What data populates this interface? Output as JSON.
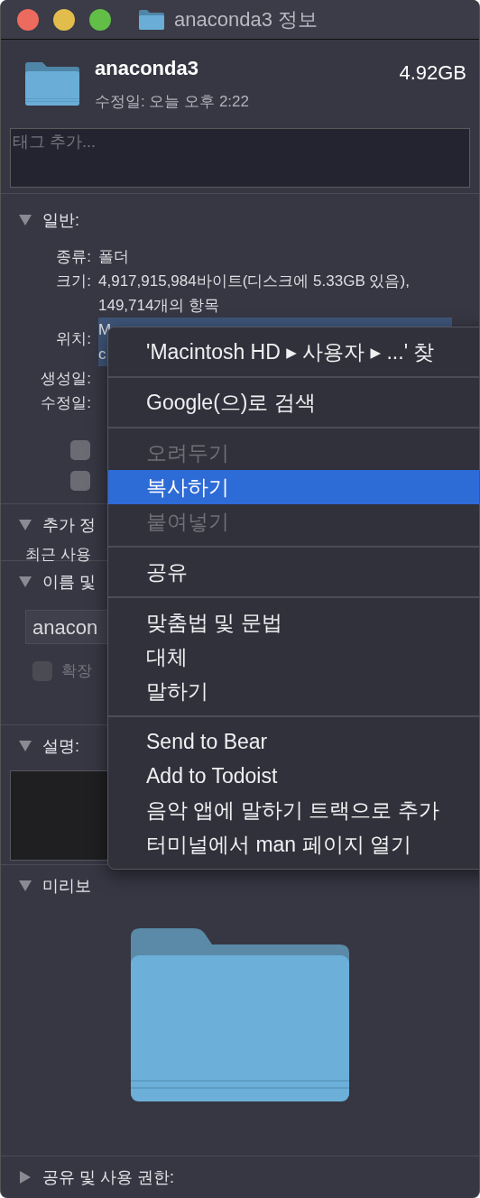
{
  "window": {
    "title": "anaconda3 정보"
  },
  "header": {
    "name": "anaconda3",
    "modified": "수정일: 오늘 오후 2:22",
    "size": "4.92GB"
  },
  "tags": {
    "placeholder": "태그 추가..."
  },
  "sections": [
    {
      "kind": "general",
      "title": "일반:",
      "expanded": true,
      "rows": [
        {
          "label": "종류:",
          "value": "폴더"
        },
        {
          "label": "크기:",
          "value": "4,917,915,984바이트(디스크에 5.33GB 있음), 149,714개의 항목"
        },
        {
          "label": "위치:",
          "value_lines": [
            "M",
            "c"
          ],
          "selected": true
        },
        {
          "label": "생성일:"
        },
        {
          "label": "수정일:"
        }
      ],
      "checkboxes": [
        {
          "checked": false
        },
        {
          "checked": false
        }
      ]
    },
    {
      "kind": "info",
      "title": "추가 정",
      "expanded": true,
      "rows": [
        {
          "label": "최근 사용"
        }
      ]
    },
    {
      "kind": "name",
      "title": "이름 및",
      "expanded": true,
      "field": {
        "value": "anacon"
      },
      "checkbox": {
        "label": "확장",
        "checked": false,
        "disabled": true
      }
    },
    {
      "kind": "comments",
      "title": "설명:",
      "expanded": true
    },
    {
      "kind": "preview",
      "title": "미리보",
      "expanded": true
    },
    {
      "kind": "sharing",
      "title": "공유 및 사용 권한:",
      "expanded": false
    }
  ],
  "menu": {
    "items": [
      {
        "kind": "item",
        "label": "'Macintosh HD ▸ 사용자 ▸ ...' 찾",
        "disabled": false,
        "selected": false
      },
      {
        "kind": "separator"
      },
      {
        "kind": "item",
        "label": "Google(으)로 검색",
        "disabled": false,
        "selected": false
      },
      {
        "kind": "separator"
      },
      {
        "kind": "item",
        "label": "오려두기",
        "disabled": true,
        "selected": false
      },
      {
        "kind": "item",
        "label": "복사하기",
        "disabled": false,
        "selected": true
      },
      {
        "kind": "item",
        "label": "붙여넣기",
        "disabled": true,
        "selected": false
      },
      {
        "kind": "separator"
      },
      {
        "kind": "item",
        "label": "공유",
        "disabled": false,
        "selected": false
      },
      {
        "kind": "separator"
      },
      {
        "kind": "item",
        "label": "맞춤법 및 문법",
        "disabled": false,
        "selected": false
      },
      {
        "kind": "item",
        "label": "대체",
        "disabled": false,
        "selected": false
      },
      {
        "kind": "item",
        "label": "말하기",
        "disabled": false,
        "selected": false
      },
      {
        "kind": "separator"
      },
      {
        "kind": "item",
        "label": "Send to Bear",
        "disabled": false,
        "selected": false
      },
      {
        "kind": "item",
        "label": "Add to Todoist",
        "disabled": false,
        "selected": false
      },
      {
        "kind": "item",
        "label": "음악 앱에 말하기 트랙으로 추가",
        "disabled": false,
        "selected": false
      },
      {
        "kind": "item",
        "label": "터미널에서 man 페이지 열기",
        "disabled": false,
        "selected": false
      }
    ]
  }
}
